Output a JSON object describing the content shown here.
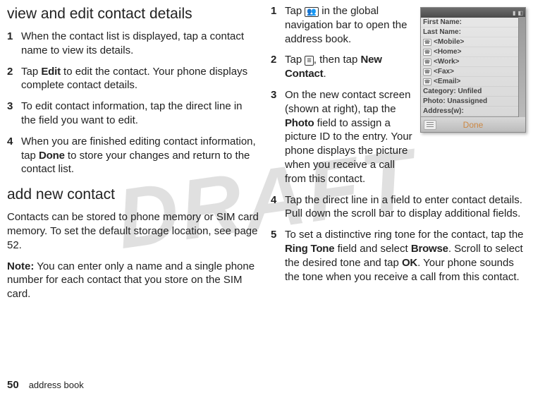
{
  "watermark": "DRAFT",
  "col1": {
    "heading1": "view and edit contact details",
    "steps1": [
      {
        "num": "1",
        "text": "When the contact list is displayed, tap a contact name to view its details."
      },
      {
        "num": "2",
        "prefix": "Tap ",
        "bold1": "Edit",
        "suffix": " to edit the contact. Your phone displays complete contact details."
      },
      {
        "num": "3",
        "text": "To edit contact information, tap the direct line in the field you want to edit."
      },
      {
        "num": "4",
        "prefix": "When you are finished editing contact information, tap ",
        "bold1": "Done",
        "suffix": " to store your changes and return to the contact list."
      }
    ],
    "heading2": "add new contact",
    "para1": "Contacts can be stored to phone memory or SIM card memory. To set the default storage location, see page 52.",
    "noteLabel": "Note:",
    "noteText": " You can enter only a name and a single phone number for each contact that you store on the SIM card."
  },
  "col2": {
    "steps": [
      {
        "num": "1",
        "prefix": "Tap ",
        "iconGlyph": "👥",
        "suffix": " in the global navigation bar to open the address book."
      },
      {
        "num": "2",
        "prefix": "Tap ",
        "iconGlyph": "≡",
        "mid": ", then tap ",
        "bold1": "New Contact",
        "suffix": "."
      },
      {
        "num": "3",
        "prefix": "On the new contact screen (shown at right), tap the ",
        "bold1": "Photo",
        "suffix": " field to assign a picture ID to the entry. Your phone displays the picture when you receive a call from this contact."
      },
      {
        "num": "4",
        "text": "Tap the direct line in a field to enter contact details. Pull down the scroll bar to display additional fields."
      },
      {
        "num": "5",
        "prefix": "To set a distinctive ring tone for the contact, tap the ",
        "bold1": "Ring Tone",
        "mid": " field and select ",
        "bold2": "Browse",
        "mid2": ". Scroll to select the desired tone and tap ",
        "bold3": "OK",
        "suffix": ". Your phone sounds the tone when you receive a call from this contact."
      }
    ]
  },
  "phone": {
    "fields": [
      {
        "label": "First Name:",
        "icon": false
      },
      {
        "label": "Last Name:",
        "icon": false
      },
      {
        "label": "<Mobile>",
        "icon": true
      },
      {
        "label": "<Home>",
        "icon": true
      },
      {
        "label": "<Work>",
        "icon": true
      },
      {
        "label": "<Fax>",
        "icon": true
      },
      {
        "label": "<Email>",
        "icon": true
      },
      {
        "label": "Category: Unfiled",
        "icon": false
      },
      {
        "label": "Photo: Unassigned",
        "icon": false
      },
      {
        "label": "Address(w):",
        "icon": false
      }
    ],
    "done": "Done"
  },
  "footer": {
    "page": "50",
    "section": "address book"
  }
}
